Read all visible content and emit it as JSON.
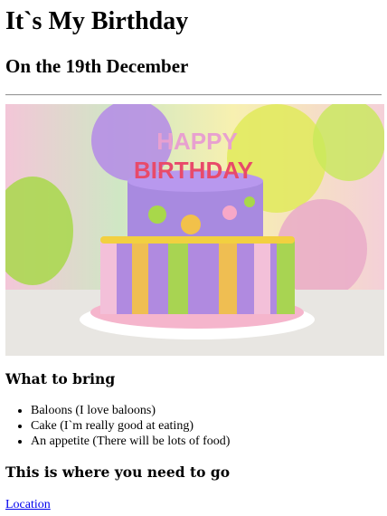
{
  "page": {
    "title": "It`s My Birthday",
    "subtitle": "On the 19th December",
    "image": {
      "alt": "Birthday cake",
      "topper_line1": "HAPPY",
      "topper_line2": "BIRTHDAY"
    },
    "bring_heading": "What to bring",
    "bring_items": [
      "Baloons (I love baloons)",
      "Cake (I`m really good at eating)",
      "An appetite (There will be lots of food)"
    ],
    "go_heading": "This is where you need to go",
    "location_link": "Location"
  }
}
